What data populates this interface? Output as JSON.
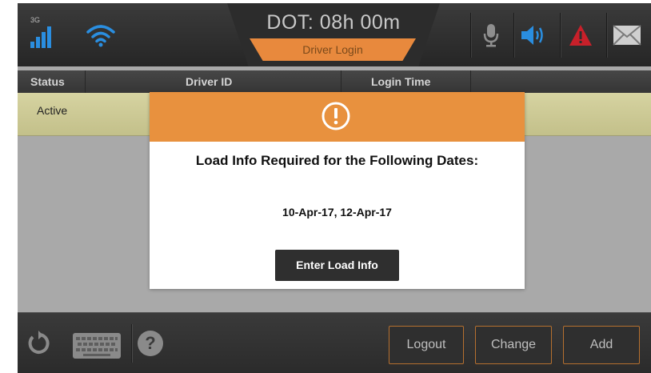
{
  "header": {
    "network_type": "3G",
    "dot_label": "DOT: 08h 00m",
    "mode_label": "Driver Login",
    "icons": [
      "signal-icon",
      "wifi-icon",
      "microphone-icon",
      "speaker-icon",
      "alert-icon",
      "mail-icon"
    ]
  },
  "table": {
    "columns": [
      "Status",
      "Driver ID",
      "Login Time"
    ],
    "rows": [
      {
        "status": "Active",
        "driver_id": "",
        "login_time": ""
      }
    ]
  },
  "modal": {
    "icon": "exclamation-icon",
    "title": "Load Info Required for the Following Dates:",
    "dates": "10-Apr-17, 12-Apr-17",
    "button_label": "Enter Load Info"
  },
  "footer": {
    "icons": [
      "refresh-icon",
      "keyboard-icon",
      "help-icon"
    ],
    "help_glyph": "?",
    "buttons": {
      "logout": "Logout",
      "change": "Change",
      "add": "Add"
    }
  },
  "colors": {
    "accent_orange": "#e8913e",
    "active_row": "#d6d3a1",
    "button_border": "#b6702f",
    "alert_red": "#c8202a",
    "speaker_blue": "#2a8ee0"
  }
}
